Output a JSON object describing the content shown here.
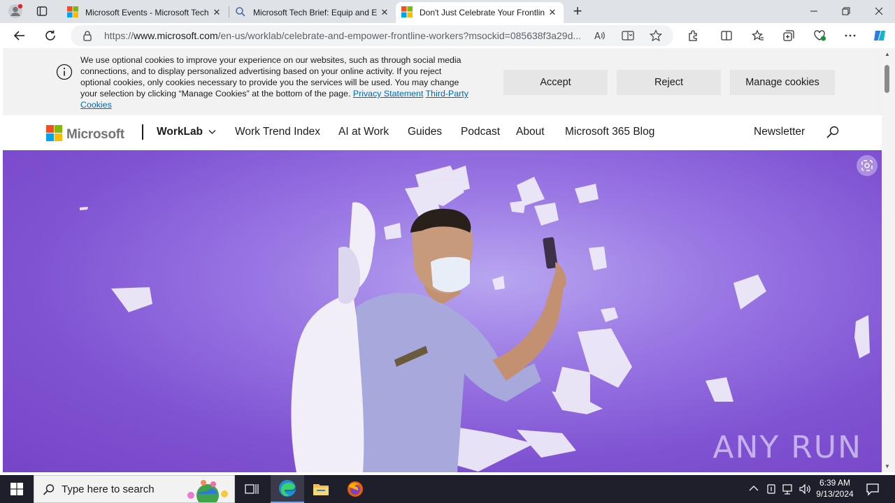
{
  "browser": {
    "tabs": [
      {
        "title": "Microsoft Events - Microsoft Tech",
        "favicon": "microsoft-logo"
      },
      {
        "title": "Microsoft Tech Brief: Equip and E",
        "favicon": "search-icon"
      },
      {
        "title": "Don't Just Celebrate Your Frontlin",
        "favicon": "microsoft-logo",
        "active": true
      }
    ],
    "url_prefix": "https://",
    "url_host": "www.microsoft.com",
    "url_path": "/en-us/worklab/celebrate-and-empower-frontline-workers?msockid=085638f3a29d..."
  },
  "cookie_banner": {
    "text": "We use optional cookies to improve your experience on our websites, such as through social media connections, and to display personalized advertising based on your online activity. If you reject optional cookies, only cookies necessary to provide you the services will be used. You may change your selection by clicking “Manage Cookies” at the bottom of the page.",
    "privacy_link": "Privacy Statement",
    "third_party_link": "Third-Party Cookies",
    "accept_label": "Accept",
    "reject_label": "Reject",
    "manage_label": "Manage cookies"
  },
  "site_nav": {
    "brand": "Microsoft",
    "section": "WorkLab",
    "items": [
      "Work Trend Index",
      "AI at Work",
      "Guides",
      "Podcast",
      "About",
      "Microsoft 365 Blog"
    ],
    "newsletter": "Newsletter"
  },
  "hero": {
    "watermark": "ANY RUN",
    "colors": {
      "background": "#8053d3",
      "accent": "#ffffff"
    }
  },
  "taskbar": {
    "search_placeholder": "Type here to search",
    "time": "6:39 AM",
    "date": "9/13/2024"
  },
  "colors": {
    "link": "#0067b8",
    "ms_red": "#f25022",
    "ms_green": "#7fba00",
    "ms_blue": "#00a4ef",
    "ms_yellow": "#ffb900"
  }
}
